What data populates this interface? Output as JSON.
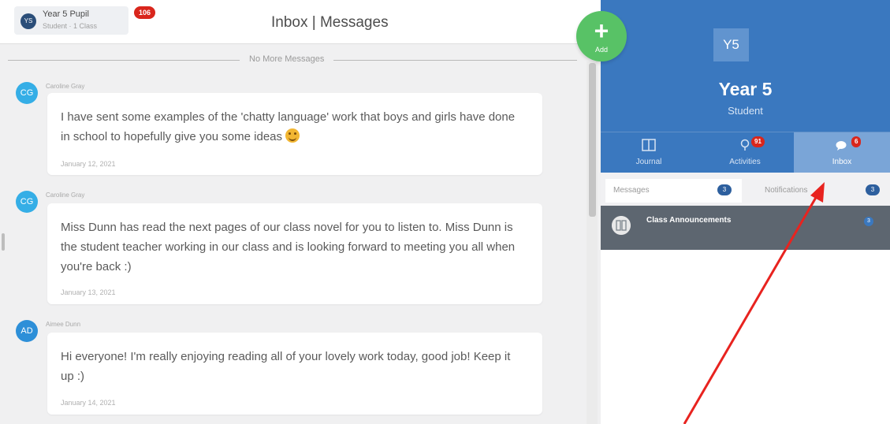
{
  "header": {
    "user_initials": "YS",
    "user_name": "Year 5 Pupil",
    "user_sub": "Student · 1 Class",
    "notification_count": "106",
    "title": "Inbox | Messages"
  },
  "thread": {
    "no_more_label": "No More Messages",
    "messages": [
      {
        "initials": "CG",
        "avatar_color": "#35aee6",
        "sender": "Caroline Gray",
        "text": "I have sent some examples of the 'chatty language' work that boys and girls have done in school to hopefully give you some ideas",
        "date": "January 12, 2021",
        "has_emoji": true
      },
      {
        "initials": "CG",
        "avatar_color": "#35aee6",
        "sender": "Caroline Gray",
        "text": "Miss Dunn has read the next pages of our class novel for you to listen to. Miss Dunn is the student teacher working in our class and is looking forward to meeting you all when you're back :)",
        "date": "January 13, 2021",
        "has_emoji": false
      },
      {
        "initials": "AD",
        "avatar_color": "#2d8fd8",
        "sender": "Aimee Dunn",
        "text": "Hi everyone! I'm really enjoying reading all of your lovely work today, good job! Keep it up :)",
        "date": "January 14, 2021",
        "has_emoji": false
      }
    ]
  },
  "add_button": {
    "icon": "plus-icon",
    "label": "Add",
    "color": "#58c266"
  },
  "profile": {
    "initials": "Y5",
    "name": "Year 5",
    "role": "Student",
    "color": "#3a78bf"
  },
  "nav": [
    {
      "icon": "journal-icon",
      "label": "Journal",
      "badge": ""
    },
    {
      "icon": "activities-icon",
      "label": "Activities",
      "badge": "91"
    },
    {
      "icon": "inbox-icon",
      "label": "Inbox",
      "badge": "6"
    }
  ],
  "tabs": {
    "messages_label": "Messages",
    "messages_count": "3",
    "notifications_label": "Notifications",
    "notifications_count": "3"
  },
  "conversations": [
    {
      "icon": "announcement-icon",
      "title": "Class Announcements",
      "count": "3"
    }
  ],
  "annotation_arrow": {
    "color": "#e8231f"
  }
}
